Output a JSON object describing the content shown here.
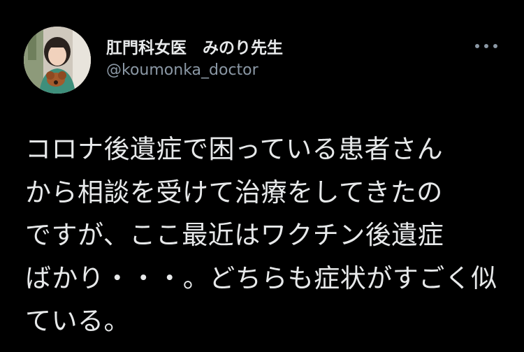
{
  "tweet": {
    "author": {
      "display_name": "肛門科女医　みのり先生",
      "handle": "@koumonka_doctor",
      "avatar_icon": "profile-photo-avatar"
    },
    "more_icon": "more-dots-icon",
    "text_lines": [
      "コロナ後遺症で困っている患者さん",
      "から相談を受けて治療をしてきたの",
      "ですが、ここ最近はワクチン後遺症",
      "ばかり・・・。どちらも症状がすごく似",
      "ている。"
    ]
  },
  "colors": {
    "background": "#000000",
    "primary_text": "#e7e9ea",
    "secondary_text": "#8b98a5"
  }
}
